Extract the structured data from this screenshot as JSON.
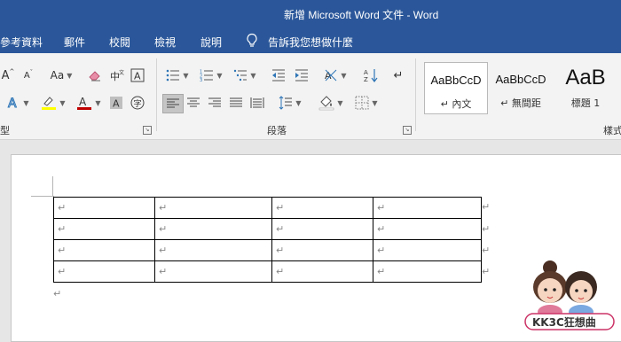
{
  "window": {
    "title": "新增 Microsoft Word 文件  -  Word"
  },
  "tabs": [
    {
      "label": "參考資料"
    },
    {
      "label": "郵件"
    },
    {
      "label": "校閱"
    },
    {
      "label": "檢視"
    },
    {
      "label": "說明"
    }
  ],
  "tell_me": {
    "label": "告訴我您想做什麼"
  },
  "ribbon": {
    "font_group_label": "型",
    "paragraph_group_label": "段落",
    "styles_group_label": "樣式",
    "change_case_label": "Aa",
    "styles": [
      {
        "sample": "AaBbCcD",
        "name": "↵ 內文"
      },
      {
        "sample": "AaBbCcD",
        "name": "↵ 無間距"
      },
      {
        "sample": "AaB",
        "name": "標題 1"
      }
    ]
  },
  "document": {
    "paragraph_mark": "↵",
    "rows": [
      [
        "↵",
        "↵",
        "↵",
        "↵"
      ],
      [
        "↵",
        "↵",
        "↵",
        "↵"
      ],
      [
        "↵",
        "↵",
        "↵",
        "↵"
      ],
      [
        "↵",
        "↵",
        "↵",
        "↵"
      ]
    ]
  },
  "watermark": {
    "text": "KK3C狂想曲"
  },
  "colors": {
    "titlebar": "#2b579a",
    "highlight": "#ffff00",
    "font_color": "#c00000"
  }
}
